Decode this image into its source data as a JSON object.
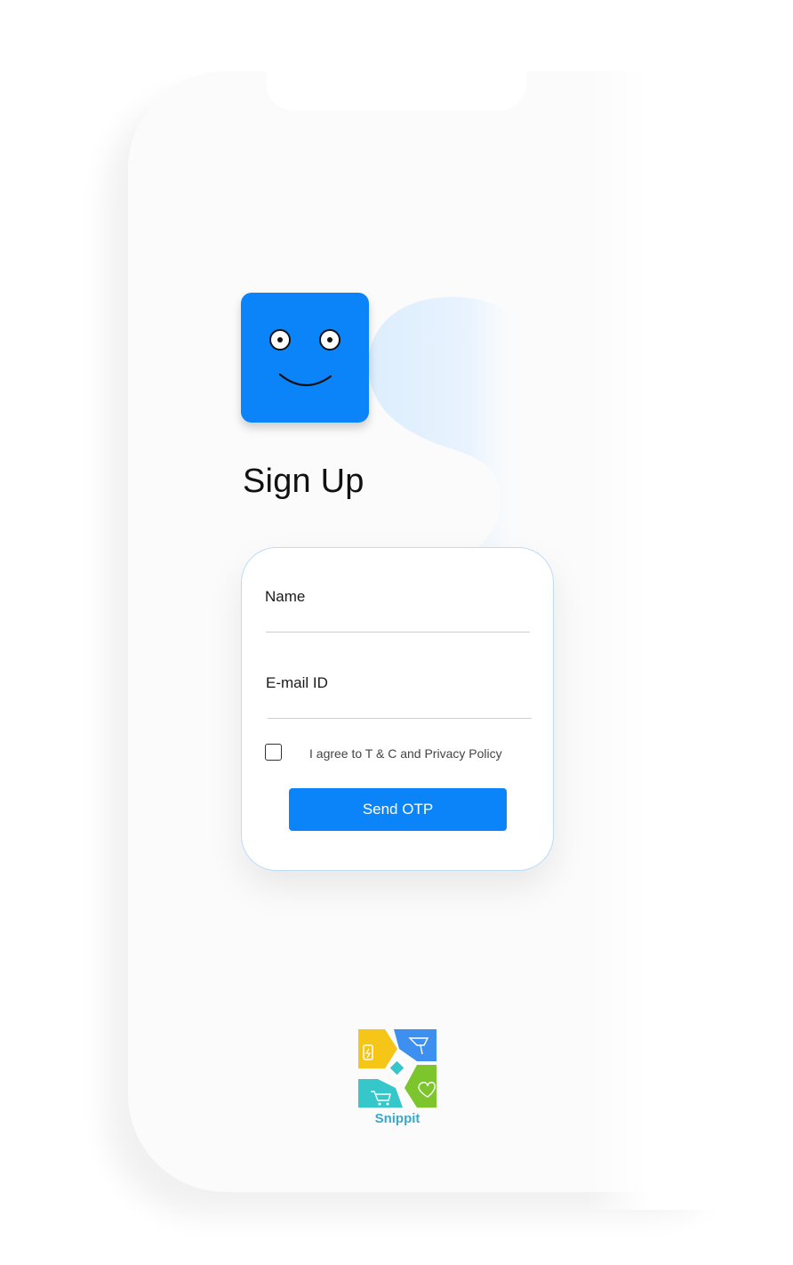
{
  "screen": {
    "title": "Sign Up"
  },
  "form": {
    "name_label": "Name",
    "email_label": "E-mail ID",
    "agree_text": "I agree to T & C and Privacy Policy",
    "agree_checked": false,
    "submit_label": "Send OTP"
  },
  "brand": {
    "logo_text": "Snippit",
    "watermark_letter": "S"
  },
  "colors": {
    "accent": "#0b84fa",
    "logo_yellow": "#f5c518",
    "logo_blue": "#3d8ff0",
    "logo_teal": "#35c7c9",
    "logo_green": "#7cc52c"
  }
}
